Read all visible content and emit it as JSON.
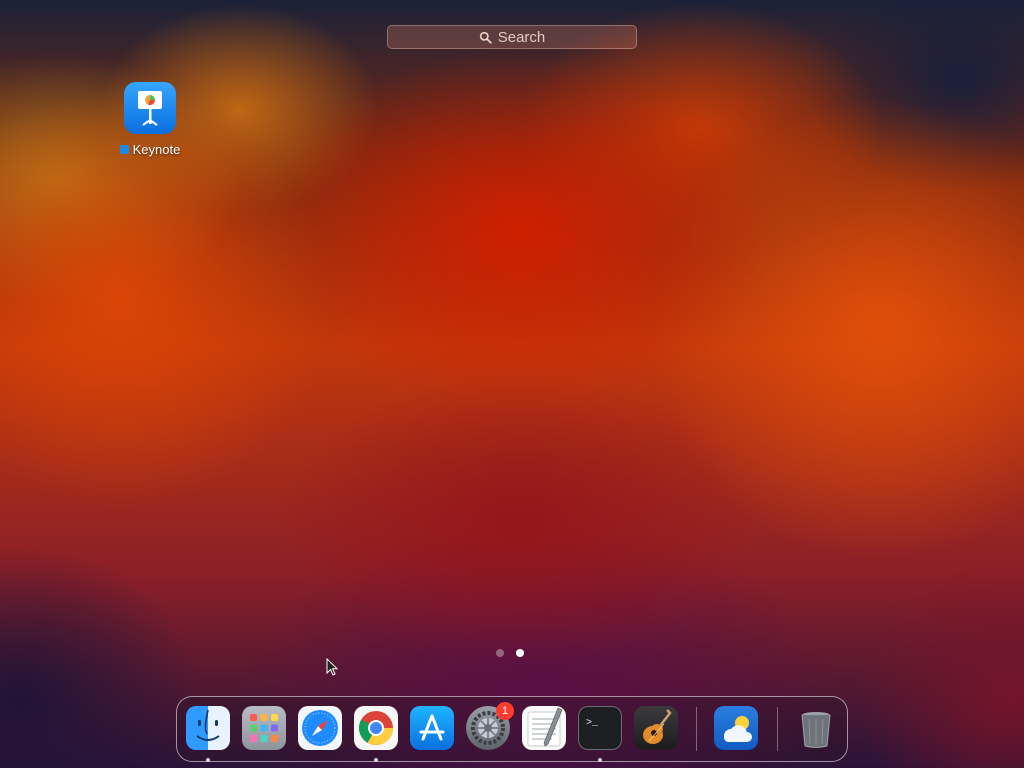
{
  "search": {
    "placeholder": "Search"
  },
  "desktop": {
    "items": [
      {
        "label": "Keynote",
        "icon": "keynote-icon",
        "tag_color": "#1e88e5"
      }
    ]
  },
  "page_indicator": {
    "pages": 2,
    "current": 2
  },
  "dock": {
    "apps": [
      {
        "name": "Finder",
        "icon": "finder-icon",
        "running": true
      },
      {
        "name": "Launchpad",
        "icon": "launchpad-icon",
        "running": false
      },
      {
        "name": "Safari",
        "icon": "safari-icon",
        "running": false
      },
      {
        "name": "Google Chrome",
        "icon": "chrome-icon",
        "running": true
      },
      {
        "name": "App Store",
        "icon": "app-store-icon",
        "running": false
      },
      {
        "name": "System Settings",
        "icon": "system-settings-icon",
        "running": false,
        "badge": "1"
      },
      {
        "name": "TextEdit",
        "icon": "textedit-icon",
        "running": false
      },
      {
        "name": "Terminal",
        "icon": "terminal-icon",
        "running": true
      },
      {
        "name": "GarageBand",
        "icon": "garageband-icon",
        "running": false
      },
      {
        "name": "Weather",
        "icon": "weather-icon",
        "running": false
      },
      {
        "name": "Trash",
        "icon": "trash-icon",
        "running": false
      }
    ]
  },
  "colors": {
    "badge": "#ff3b30",
    "accent": "#0a6fe0"
  }
}
